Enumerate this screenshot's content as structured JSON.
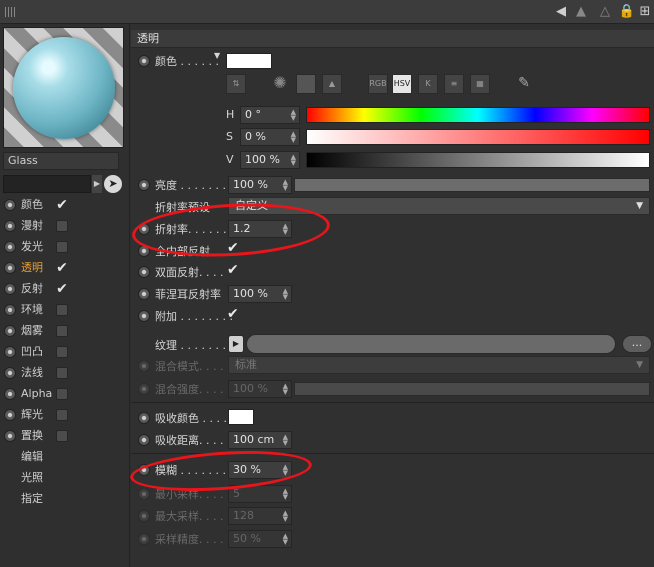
{
  "left": {
    "material_name": "Glass",
    "channels": [
      {
        "label": "颜色",
        "checked": true,
        "active": false
      },
      {
        "label": "漫射",
        "checked": false,
        "active": false
      },
      {
        "label": "发光",
        "checked": false,
        "active": false
      },
      {
        "label": "透明",
        "checked": true,
        "active": true
      },
      {
        "label": "反射",
        "checked": true,
        "active": false
      },
      {
        "label": "环境",
        "checked": false,
        "active": false
      },
      {
        "label": "烟雾",
        "checked": false,
        "active": false
      },
      {
        "label": "凹凸",
        "checked": false,
        "active": false
      },
      {
        "label": "法线",
        "checked": false,
        "active": false
      },
      {
        "label": "Alpha",
        "checked": false,
        "active": false
      },
      {
        "label": "辉光",
        "checked": false,
        "active": false
      },
      {
        "label": "置换",
        "checked": false,
        "active": false
      },
      {
        "label": "编辑",
        "checked": null,
        "active": false
      },
      {
        "label": "光照",
        "checked": null,
        "active": false
      },
      {
        "label": "指定",
        "checked": null,
        "active": false
      }
    ]
  },
  "section_title": "透明",
  "color": {
    "label": "颜色 . . . . . .",
    "swatch": "#ffffff",
    "modes": [
      "RGB",
      "HSV",
      "K"
    ],
    "h_label": "H",
    "h_value": "0 °",
    "s_label": "S",
    "s_value": "0 %",
    "v_label": "V",
    "v_value": "100 %"
  },
  "props": {
    "brightness_label": "亮度 . . . . . . . .",
    "brightness_value": "100 %",
    "ior_preset_label": "折射率预设",
    "ior_preset_value": "自定义",
    "ior_label": "折射率. . . . . .",
    "ior_value": "1.2",
    "total_internal_label": "全内部反射",
    "double_sided_label": "双面反射. . . .",
    "fresnel_label": "菲涅耳反射率",
    "fresnel_value": "100 %",
    "additive_label": "附加 . . . . . . . .",
    "texture_label": "纹理 . . . . . . . .",
    "mix_mode_label": "混合模式. . . . .",
    "mix_mode_value": "标准",
    "mix_strength_label": "混合强度. . . . .",
    "mix_strength_value": "100 %",
    "absorb_color_label": "吸收颜色 . . . .",
    "absorb_dist_label": "吸收距离. . . .",
    "absorb_dist_value": "100 cm",
    "blur_label": "模糊 . . . . . . . .",
    "blur_value": "30 %",
    "min_samples_label": "最小采样. . . . .",
    "min_samples_value": "5",
    "max_samples_label": "最大采样. . . . .",
    "max_samples_value": "128",
    "accuracy_label": "采样精度. . . . .",
    "accuracy_value": "50 %"
  },
  "colors": {
    "annotation": "#e8151b",
    "active_channel": "#e8a035"
  }
}
